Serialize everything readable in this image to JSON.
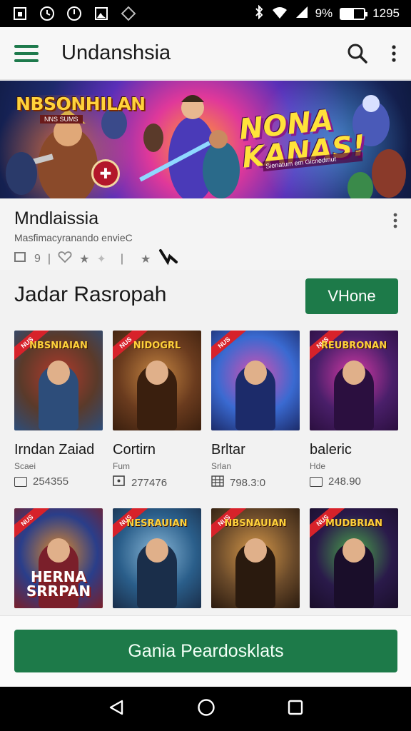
{
  "status_bar": {
    "battery_percent": "9%",
    "time": "1295",
    "battery_level": 0.55
  },
  "app_bar": {
    "title": "Undanshsia"
  },
  "banner": {
    "logo": "NBSONHILAN",
    "logo_sub": "NNS SUMS",
    "headline_line1": "NONA",
    "headline_line2": "KANAS!",
    "tagline": "Sienatum em Gicnedmut"
  },
  "featured": {
    "title": "Mndlaissia",
    "subtitle": "Masfimacyranando envieC",
    "count": "9"
  },
  "section": {
    "title": "Jadar Rasropah",
    "view_button": "VHone"
  },
  "cards_row1": [
    {
      "thumb_title": "NBSNIAIAN",
      "ribbon": "NUS",
      "name": "Irndan Zaiad",
      "category": "Scaei",
      "count": "254355",
      "icon": "box-icon",
      "colors": [
        "#5a3a2a",
        "#b23a2c",
        "#2d4d7a"
      ]
    },
    {
      "thumb_title": "NIDOGRL",
      "ribbon": "NUS",
      "name": "Cortirn",
      "category": "Fum",
      "count": "277476",
      "icon": "dot-box-icon",
      "colors": [
        "#6a3b1e",
        "#c68642",
        "#3a1f0e"
      ]
    },
    {
      "thumb_title": "",
      "ribbon": "NUS",
      "name": "Brltar",
      "category": "Srlan",
      "count": "798.3:0",
      "icon": "grid-icon",
      "colors": [
        "#3a6ad1",
        "#d84fb0",
        "#1c2b6a"
      ]
    },
    {
      "thumb_title": "REUBRONAN",
      "ribbon": "NUS",
      "name": "baleric",
      "category": "Hde",
      "count": "248.90",
      "icon": "box-icon",
      "colors": [
        "#4a1f6a",
        "#d83aa6",
        "#2b0f3f"
      ]
    }
  ],
  "cards_row2": [
    {
      "thumb_title": "",
      "ribbon": "NUS",
      "bottom_text": "HERNA SRRPAN",
      "colors": [
        "#2a3e8a",
        "#e08a2a",
        "#7a1f2a"
      ]
    },
    {
      "thumb_title": "NESRAUIAN",
      "ribbon": "NUS",
      "bottom_text": "",
      "colors": [
        "#2a5e8a",
        "#8ab8d8",
        "#1a2e4a"
      ]
    },
    {
      "thumb_title": "NBSNAUIAN",
      "ribbon": "NUS",
      "bottom_text": "",
      "colors": [
        "#6a4a2a",
        "#d89a4a",
        "#2a1a0e"
      ]
    },
    {
      "thumb_title": "MUDBRIAN",
      "ribbon": "NUS",
      "bottom_text": "",
      "colors": [
        "#2a1a4a",
        "#4aa84a",
        "#1a0e2a"
      ]
    }
  ],
  "cta": {
    "label": "Gania Peardosklats"
  },
  "colors": {
    "accent": "#1d7a49",
    "status_bar": "#000000"
  }
}
